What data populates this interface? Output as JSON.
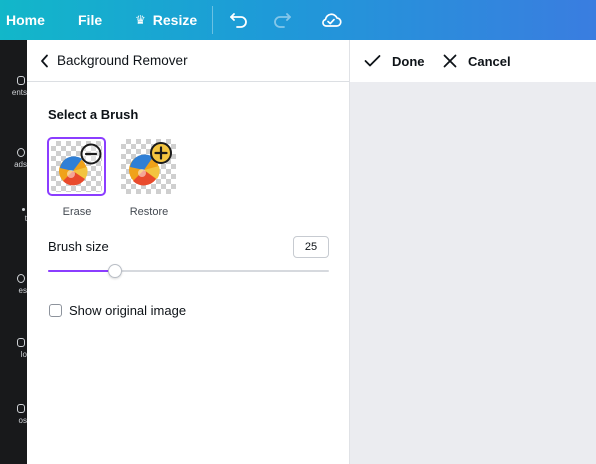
{
  "topbar": {
    "home_label": "Home",
    "file_label": "File",
    "resize_label": "Resize",
    "icons": [
      "crown-icon",
      "undo-icon",
      "redo-icon",
      "cloud-saved-icon"
    ]
  },
  "rail": {
    "items": [
      {
        "label": "ents",
        "icon": "elements-icon"
      },
      {
        "label": "ads",
        "icon": "uploads-icon"
      },
      {
        "label": "t",
        "icon": "text-icon"
      },
      {
        "label": "es",
        "icon": "styles-icon"
      },
      {
        "label": "lo",
        "icon": "audio-icon"
      },
      {
        "label": "os",
        "icon": "videos-icon"
      }
    ]
  },
  "panel": {
    "title": "Background Remover",
    "section_label": "Select a Brush",
    "brushes": [
      {
        "label": "Erase",
        "selected": true,
        "badge_icon": "minus-icon"
      },
      {
        "label": "Restore",
        "selected": false,
        "badge_icon": "plus-icon"
      }
    ],
    "brush_size_label": "Brush size",
    "brush_size_value": "25",
    "brush_size_fraction": 0.24,
    "show_original_label": "Show original image",
    "show_original_checked": false
  },
  "actions": {
    "done_label": "Done",
    "cancel_label": "Cancel"
  },
  "colors": {
    "accent": "#8b3dff",
    "topbar_start": "#12b7c9",
    "topbar_end": "#3a7de0",
    "rail_bg": "#18191b",
    "canvas_bg": "#ebecf0"
  }
}
